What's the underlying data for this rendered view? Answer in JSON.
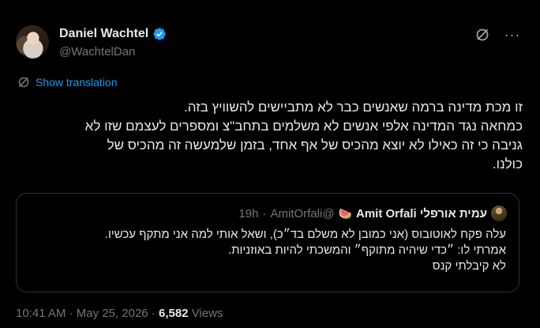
{
  "author": {
    "name": "Daniel Wachtel",
    "handle": "@WachtelDan"
  },
  "translate_label": "Show translation",
  "tweet_lines": [
    "זו מכת מדינה ברמה שאנשים כבר לא מתביישים להשוויץ בזה.",
    "כמחאה נגד המדינה אלפי אנשים לא משלמים בתחב\"צ ומספרים לעצמם שזו לא",
    "גניבה כי זה כאילו לא יוצא מהכיס של אף אחד, בזמן שלמעשה זה מהכיס של",
    "כולנו."
  ],
  "quoted": {
    "name": "עמית אורפלי Amit Orfali",
    "emoji": "🍉",
    "handle": "@AmitOrfali",
    "separator": "·",
    "time": "19h",
    "lines": [
      "עלה פקח לאוטובוס (אני כמובן לא משלם בד״כ), ושאל אותי למה אני מתקף עכשיו.",
      "אמרתי לו: ״כדי שיהיה מתוקף״ והמשכתי להיות באוזניות.",
      "לא קיבלתי קנס"
    ]
  },
  "meta": {
    "time": "10:41 AM",
    "separator": "·",
    "date": "May 25, 2026",
    "views_count": "6,582",
    "views_label": "Views"
  },
  "colors": {
    "background": "#000000",
    "accent": "#1d9bf0",
    "muted": "#71767b",
    "text": "#e7e9ea",
    "border": "#2f3336"
  }
}
